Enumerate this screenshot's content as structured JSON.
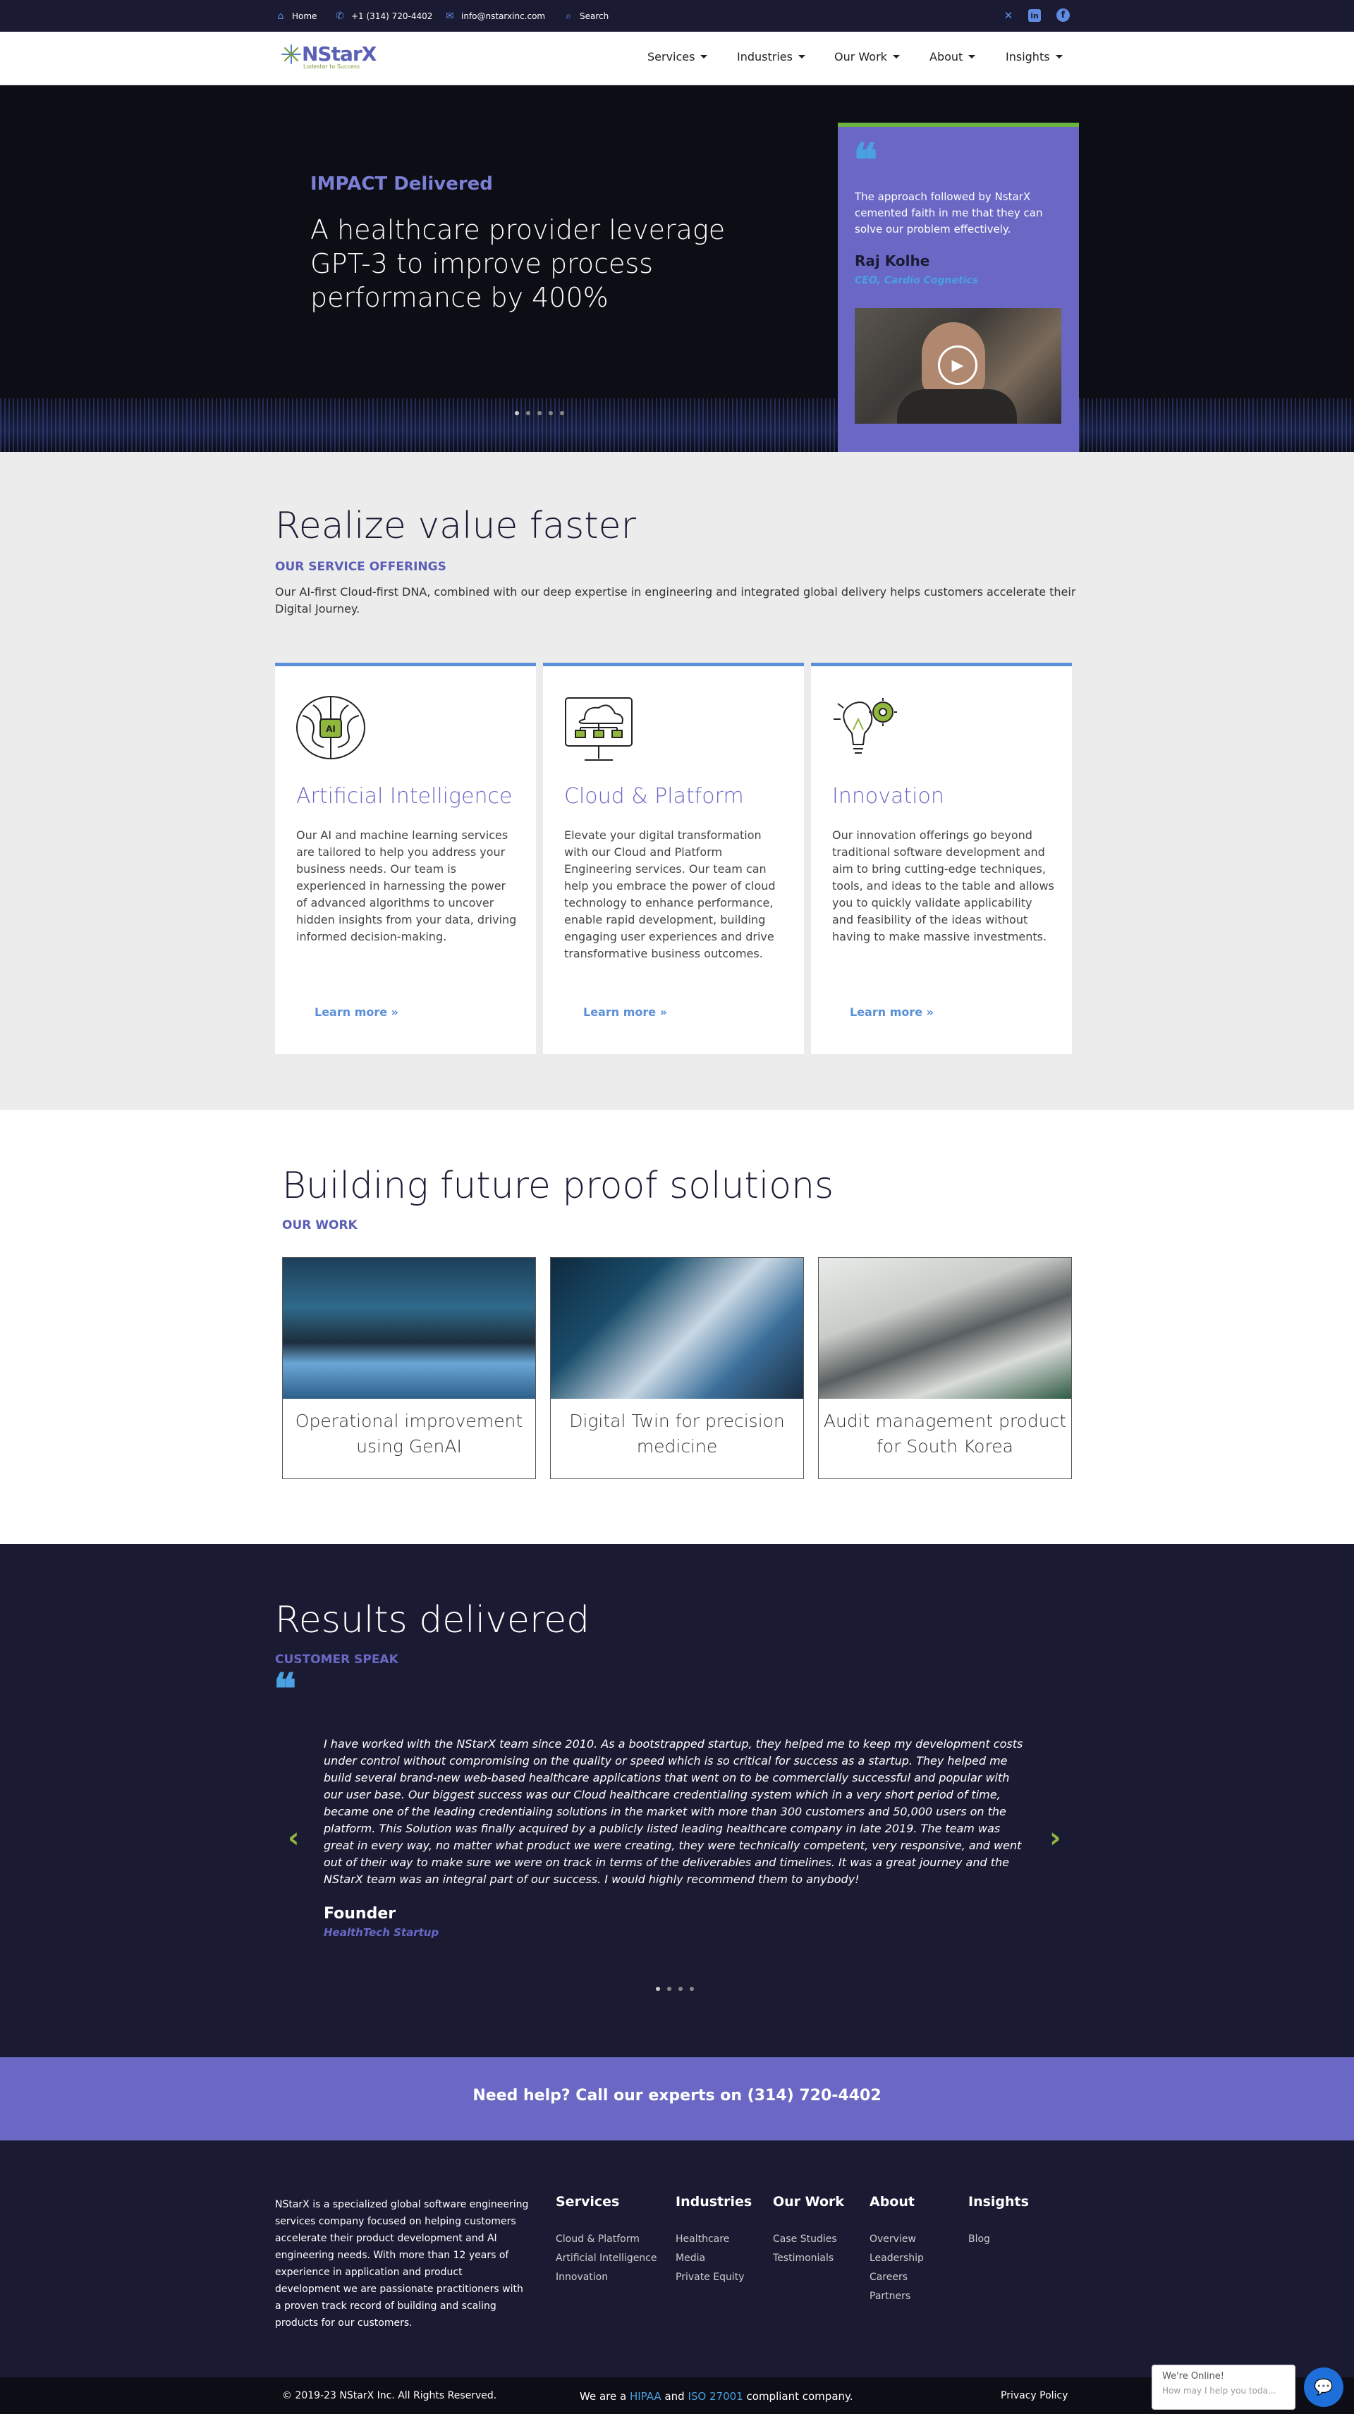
{
  "topbar": {
    "home": "Home",
    "phone": "+1 (314) 720-4402",
    "email": "info@nstarxinc.com",
    "search": "Search"
  },
  "header": {
    "logo_text": "NStarX",
    "logo_tag": "Lodestar to Success",
    "nav": [
      "Services",
      "Industries",
      "Our Work",
      "About",
      "Insights"
    ]
  },
  "hero": {
    "kicker": "IMPACT Delivered",
    "title": "A healthcare provider leverage GPT-3 to improve process performance by 400%",
    "slides_total": 5,
    "slides_active": 1,
    "testimonial": {
      "quote": "The approach followed by NstarX cemented faith in me that they can solve our problem effectively.",
      "name": "Raj Kolhe",
      "role": "CEO, Cardio Cognetics"
    }
  },
  "realize": {
    "title": "Realize value faster",
    "kicker": "OUR SERVICE OFFERINGS",
    "description": "Our AI-first Cloud-first DNA, combined with our deep expertise in engineering and integrated global delivery helps customers accelerate their Digital Journey.",
    "cards": [
      {
        "title": "Artificial Intelligence",
        "text": "Our AI and machine learning services are tailored to help you address your business needs. Our team is experienced in  harnessing the power of advanced algorithms to uncover hidden insights from your data, driving informed decision-making.",
        "link": "Learn more »",
        "icon": "ai-brain-icon"
      },
      {
        "title": "Cloud & Platform",
        "text": "Elevate your digital transformation with our Cloud and Platform Engineering services. Our team can help you embrace the power of cloud technology to enhance performance, enable rapid development, building engaging user experiences and drive transformative business outcomes.",
        "link": "Learn more »",
        "icon": "cloud-monitor-icon"
      },
      {
        "title": "Innovation",
        "text": "Our innovation offerings go beyond traditional software development and aim to bring cutting-edge techniques, tools, and ideas to the table and allows you to quickly validate applicability and feasibility of the ideas without having to make massive investments.",
        "link": "Learn more »",
        "icon": "lightbulb-gear-icon"
      }
    ]
  },
  "work": {
    "title": "Building future proof solutions",
    "kicker": "OUR WORK",
    "items": [
      {
        "caption": "Operational improvement using GenAI"
      },
      {
        "caption": "Digital Twin for precision medicine"
      },
      {
        "caption": "Audit management product for South Korea"
      }
    ]
  },
  "results": {
    "title": "Results delivered",
    "kicker": "CUSTOMER SPEAK",
    "quote": "I have worked with the NStarX team since 2010. As a bootstrapped startup, they helped me to keep my development costs under control without compromising on the quality or speed which is so critical for success as a startup. They helped me build several brand-new web-based healthcare applications that went on to be commercially successful and popular with our user base. Our biggest success was our Cloud healthcare credentialing system which in a very short period of time, became one of the leading credentialing solutions in the market with more than 300 customers and 50,000 users on the platform. This Solution was finally acquired by a publicly listed leading healthcare company in late 2019. The team was great in every way, no matter what product we were creating, they were technically competent, very responsive, and went out of their way to make sure we were on track in terms of the deliverables and timelines. It was a great journey and the NStarX team was an integral part of our success. I would highly recommend them to anybody!",
    "name": "Founder",
    "role": "HealthTech Startup",
    "slides_total": 4,
    "slides_active": 1
  },
  "cta": {
    "text": "Need help? Call our experts on (314) 720-4402"
  },
  "footer": {
    "about": "NStarX is a specialized global software engineering services company focused on helping customers accelerate their product development and AI engineering needs. With more than 12 years of experience in application and product development we are passionate practitioners with a proven track record of building and scaling products for our customers.",
    "columns": [
      {
        "head": "Services",
        "links": [
          "Cloud & Platform",
          "Artificial Intelligence",
          "Innovation"
        ]
      },
      {
        "head": "Industries",
        "links": [
          "Healthcare",
          "Media",
          "Private Equity"
        ]
      },
      {
        "head": "Our Work",
        "links": [
          "Case Studies",
          "Testimonials"
        ]
      },
      {
        "head": "About",
        "links": [
          "Overview",
          "Leadership",
          "Careers",
          "Partners"
        ]
      },
      {
        "head": "Insights",
        "links": [
          "Blog"
        ]
      }
    ],
    "copyright": "© 2019-23 NStarX Inc. All Rights Reserved.",
    "compliance_pre": "We are a",
    "compliance_hipaa": "HIPAA",
    "compliance_and": "and",
    "compliance_iso": "ISO 27001",
    "compliance_post": "compliant company.",
    "privacy": "Privacy Policy"
  },
  "chat": {
    "status": "We're Online!",
    "prompt": "How may I help you toda..."
  },
  "colors": {
    "accent": "#6a68c4",
    "navy": "#1a1b33",
    "blue": "#5a8fd8",
    "green": "#8fb73e"
  }
}
